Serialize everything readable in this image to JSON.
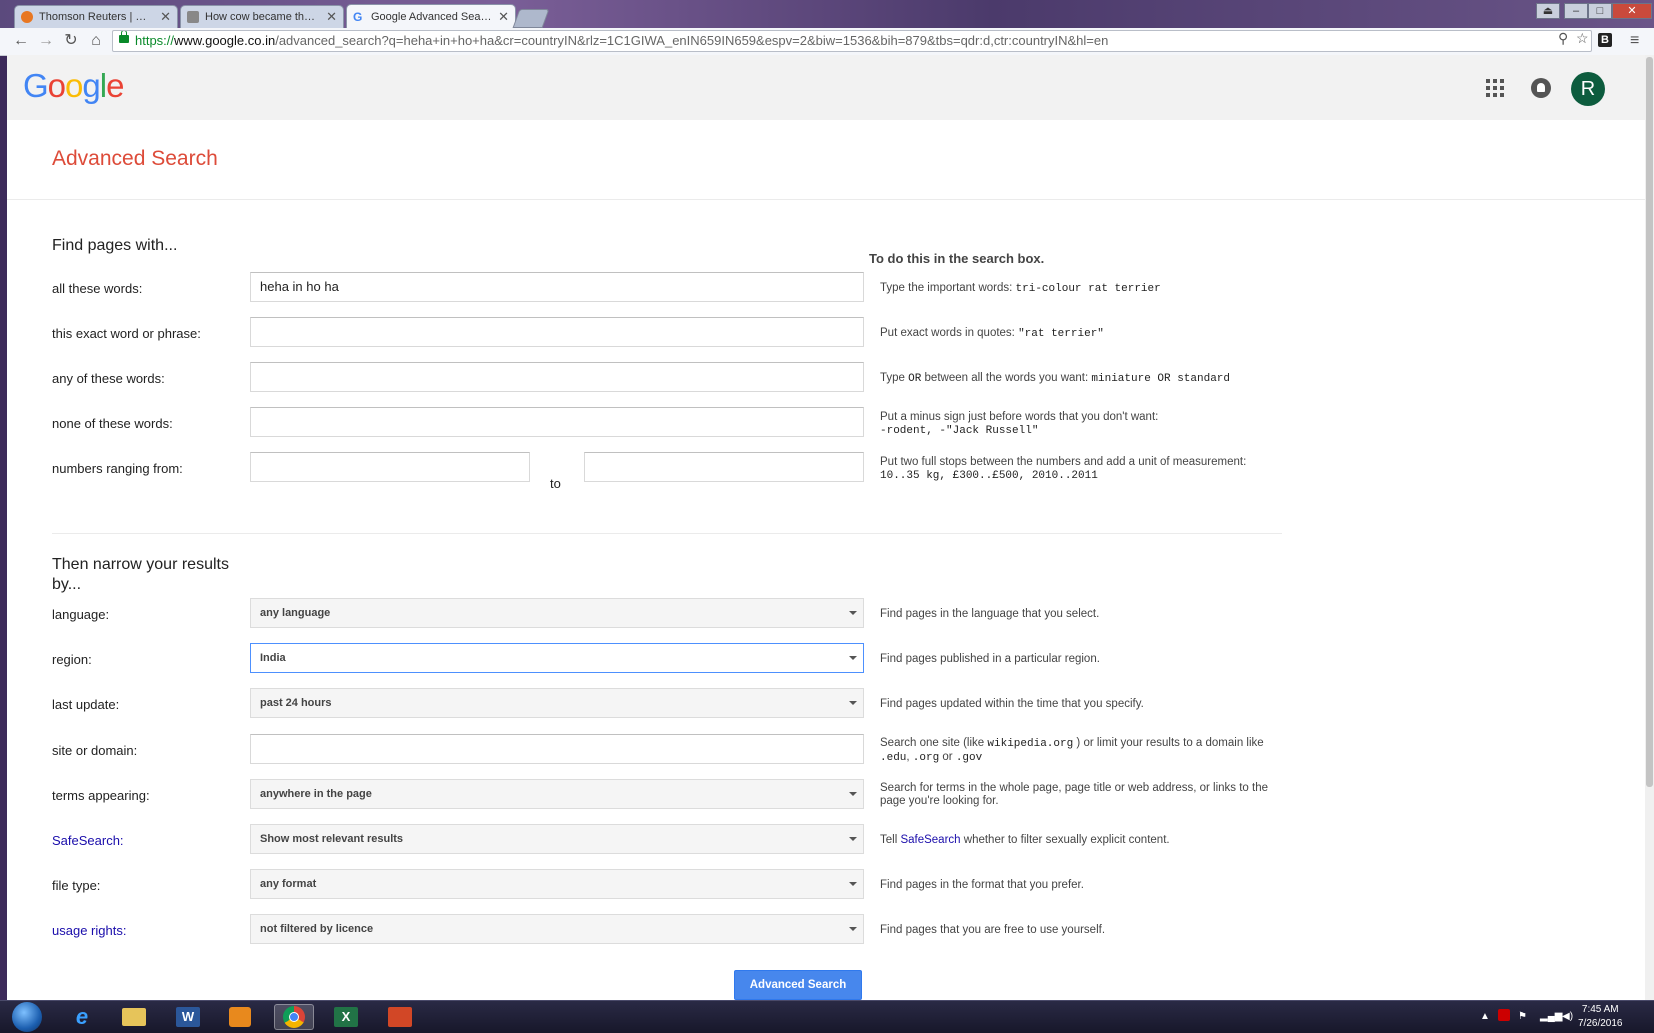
{
  "browser": {
    "tabs": [
      {
        "title": "Thomson Reuters | Open",
        "favicon_color": "#e87722"
      },
      {
        "title": "How cow became the mo",
        "favicon_color": "#888888"
      },
      {
        "title": "Google Advanced Search",
        "favicon_color": "#4285f4"
      }
    ],
    "url": {
      "scheme": "https://",
      "host": "www.google.co.in",
      "path": "/advanced_search?q=heha+in+ho+ha&cr=countryIN&rlz=1C1GIWA_enIN659IN659&espv=2&biw=1536&bih=879&tbs=qdr:d,ctr:countryIN&hl=en"
    },
    "extension_label": "B"
  },
  "header": {
    "logo_letters": [
      {
        "ch": "G",
        "color": "#4285f4"
      },
      {
        "ch": "o",
        "color": "#ea4335"
      },
      {
        "ch": "o",
        "color": "#fbbc05"
      },
      {
        "ch": "g",
        "color": "#4285f4"
      },
      {
        "ch": "l",
        "color": "#34a853"
      },
      {
        "ch": "e",
        "color": "#ea4335"
      }
    ],
    "avatar_initial": "R"
  },
  "page_title": "Advanced Search",
  "find_section": {
    "title": "Find pages with...",
    "side_title": "To do this in the search box.",
    "all_words": {
      "label": "all these words:",
      "value": "heha in ho ha",
      "hint_text": "Type the important words: ",
      "hint_code": "tri-colour rat terrier"
    },
    "exact_phrase": {
      "label": "this exact word or phrase:",
      "value": "",
      "hint_text": "Put exact words in quotes: ",
      "hint_code": "\"rat terrier\""
    },
    "any_words": {
      "label": "any of these words:",
      "value": "",
      "hint_a": "Type ",
      "hint_code1": "OR",
      "hint_b": " between all the words you want: ",
      "hint_code2": "miniature OR standard"
    },
    "none_words": {
      "label": "none of these words:",
      "value": "",
      "hint_text": "Put a minus sign just before words that you don't want:",
      "hint_code": "-rodent, -\"Jack Russell\""
    },
    "numbers": {
      "label": "numbers ranging from:",
      "from_value": "",
      "to_label": "to",
      "to_value": "",
      "hint_text": "Put two full stops between the numbers and add a unit of measurement:",
      "hint_code": "10..35 kg, £300..£500, 2010..2011"
    }
  },
  "narrow_section": {
    "title": "Then narrow your results by...",
    "language": {
      "label": "language:",
      "value": "any language",
      "hint": "Find pages in the language that you select."
    },
    "region": {
      "label": "region:",
      "value": "India",
      "hint": "Find pages published in a particular region."
    },
    "last_update": {
      "label": "last update:",
      "value": "past 24 hours",
      "hint": "Find pages updated within the time that you specify."
    },
    "site": {
      "label": "site or domain:",
      "value": "",
      "hint_a": "Search one site (like ",
      "hint_code1": "wikipedia.org",
      "hint_b": " ) or limit your results to a domain like ",
      "hint_code2": ".edu",
      "hint_c": ", ",
      "hint_code3": ".org",
      "hint_d": " or ",
      "hint_code4": ".gov"
    },
    "terms": {
      "label": "terms appearing:",
      "value": "anywhere in the page",
      "hint": "Search for terms in the whole page, page title or web address, or links to the page you're looking for."
    },
    "safesearch": {
      "label": "SafeSearch:",
      "value": "Show most relevant results",
      "hint_a": "Tell ",
      "hint_link": "SafeSearch",
      "hint_b": " whether to filter sexually explicit content."
    },
    "file_type": {
      "label": "file type:",
      "value": "any format",
      "hint": "Find pages in the format that you prefer."
    },
    "usage_rights": {
      "label": "usage rights:",
      "value": "not filtered by licence",
      "hint": "Find pages that you are free to use yourself."
    }
  },
  "submit_label": "Advanced Search",
  "taskbar": {
    "clock_time": "7:45 AM",
    "clock_date": "7/26/2016"
  }
}
